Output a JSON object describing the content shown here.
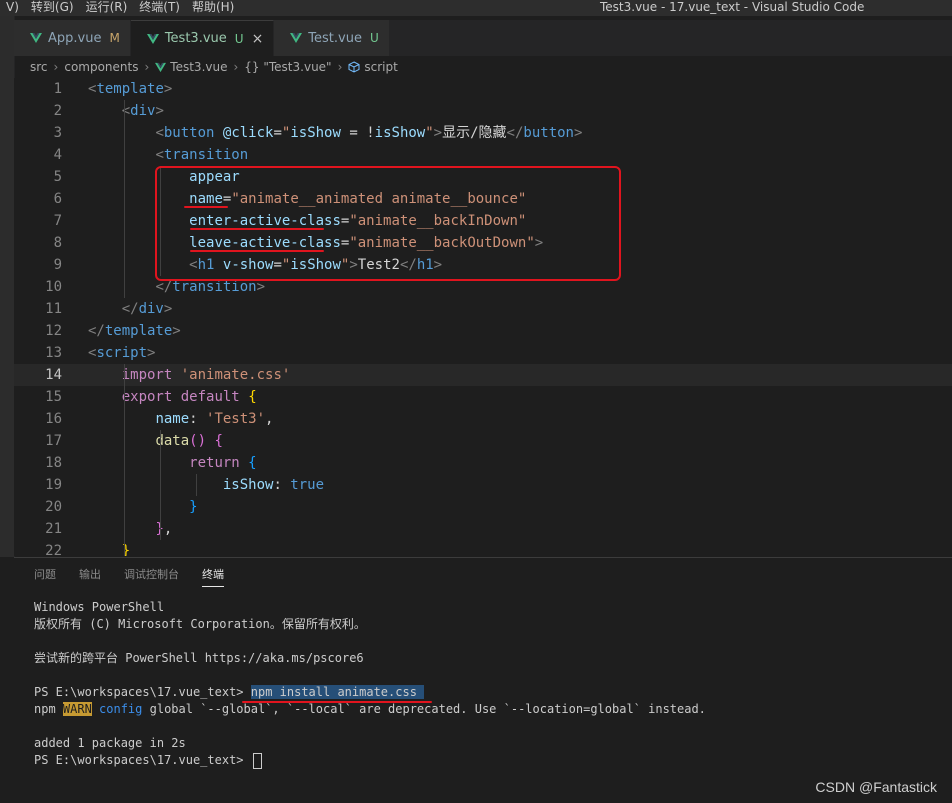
{
  "menu": [
    "V)",
    "转到(G)",
    "运行(R)",
    "终端(T)",
    "帮助(H)"
  ],
  "window_title": "Test3.vue - 17.vue_text - Visual Studio Code",
  "tabs": [
    {
      "label": "App.vue",
      "badge": "M",
      "active": false
    },
    {
      "label": "Test3.vue",
      "badge": "U",
      "active": true,
      "close": "×"
    },
    {
      "label": "Test.vue",
      "badge": "U",
      "active": false
    }
  ],
  "breadcrumb": [
    "src",
    "components",
    "Test3.vue",
    "{} \"Test3.vue\"",
    "script"
  ],
  "code_lines": [
    {
      "n": "1",
      "tokens": [
        [
          "t-punc",
          "<"
        ],
        [
          "t-tag",
          "template"
        ],
        [
          "t-punc",
          ">"
        ]
      ]
    },
    {
      "n": "2",
      "tokens": [
        [
          "t-text",
          "    "
        ],
        [
          "t-punc",
          "<"
        ],
        [
          "t-tag",
          "div"
        ],
        [
          "t-punc",
          ">"
        ]
      ]
    },
    {
      "n": "3",
      "tokens": [
        [
          "t-text",
          "        "
        ],
        [
          "t-punc",
          "<"
        ],
        [
          "t-tag",
          "button"
        ],
        [
          "t-text",
          " "
        ],
        [
          "t-attr",
          "@click"
        ],
        [
          "t-text",
          "="
        ],
        [
          "t-str",
          "\""
        ],
        [
          "t-attr",
          "isShow"
        ],
        [
          "t-text",
          " = "
        ],
        [
          "t-text",
          "!"
        ],
        [
          "t-attr",
          "isShow"
        ],
        [
          "t-str",
          "\""
        ],
        [
          "t-punc",
          ">"
        ],
        [
          "t-text",
          "显示/隐藏"
        ],
        [
          "t-punc",
          "</"
        ],
        [
          "t-tag",
          "button"
        ],
        [
          "t-punc",
          ">"
        ]
      ]
    },
    {
      "n": "4",
      "tokens": [
        [
          "t-text",
          "        "
        ],
        [
          "t-punc",
          "<"
        ],
        [
          "t-tag",
          "transition"
        ]
      ]
    },
    {
      "n": "5",
      "tokens": [
        [
          "t-text",
          "            "
        ],
        [
          "t-attr",
          "appear"
        ]
      ]
    },
    {
      "n": "6",
      "tokens": [
        [
          "t-text",
          "            "
        ],
        [
          "t-attr",
          "name"
        ],
        [
          "t-text",
          "="
        ],
        [
          "t-str",
          "\"animate__animated animate__bounce\""
        ]
      ]
    },
    {
      "n": "7",
      "tokens": [
        [
          "t-text",
          "            "
        ],
        [
          "t-attr",
          "enter-active-class"
        ],
        [
          "t-text",
          "="
        ],
        [
          "t-str",
          "\"animate__backInDown\""
        ]
      ]
    },
    {
      "n": "8",
      "tokens": [
        [
          "t-text",
          "            "
        ],
        [
          "t-attr",
          "leave-active-class"
        ],
        [
          "t-text",
          "="
        ],
        [
          "t-str",
          "\"animate__backOutDown\""
        ],
        [
          "t-punc",
          ">"
        ]
      ]
    },
    {
      "n": "9",
      "tokens": [
        [
          "t-text",
          "            "
        ],
        [
          "t-punc",
          "<"
        ],
        [
          "t-tag",
          "h1"
        ],
        [
          "t-text",
          " "
        ],
        [
          "t-attr",
          "v-show"
        ],
        [
          "t-text",
          "="
        ],
        [
          "t-str",
          "\""
        ],
        [
          "t-attr",
          "isShow"
        ],
        [
          "t-str",
          "\""
        ],
        [
          "t-punc",
          ">"
        ],
        [
          "t-text",
          "Test2"
        ],
        [
          "t-punc",
          "</"
        ],
        [
          "t-tag",
          "h1"
        ],
        [
          "t-punc",
          ">"
        ]
      ]
    },
    {
      "n": "10",
      "tokens": [
        [
          "t-text",
          "        "
        ],
        [
          "t-punc",
          "</"
        ],
        [
          "t-tag",
          "transition"
        ],
        [
          "t-punc",
          ">"
        ]
      ]
    },
    {
      "n": "11",
      "tokens": [
        [
          "t-text",
          "    "
        ],
        [
          "t-punc",
          "</"
        ],
        [
          "t-tag",
          "div"
        ],
        [
          "t-punc",
          ">"
        ]
      ]
    },
    {
      "n": "12",
      "tokens": [
        [
          "t-punc",
          "</"
        ],
        [
          "t-tag",
          "template"
        ],
        [
          "t-punc",
          ">"
        ]
      ]
    },
    {
      "n": "13",
      "tokens": [
        [
          "t-punc",
          "<"
        ],
        [
          "t-tag",
          "script"
        ],
        [
          "t-punc",
          ">"
        ]
      ]
    },
    {
      "n": "14",
      "tokens": [
        [
          "t-text",
          "    "
        ],
        [
          "t-kw",
          "import"
        ],
        [
          "t-text",
          " "
        ],
        [
          "t-str",
          "'animate.css'"
        ]
      ],
      "current": true
    },
    {
      "n": "15",
      "tokens": [
        [
          "t-text",
          "    "
        ],
        [
          "t-kw",
          "export"
        ],
        [
          "t-text",
          " "
        ],
        [
          "t-kw",
          "default"
        ],
        [
          "t-text",
          " "
        ],
        [
          "t-b1",
          "{"
        ]
      ]
    },
    {
      "n": "16",
      "tokens": [
        [
          "t-text",
          "        "
        ],
        [
          "t-prop",
          "name"
        ],
        [
          "t-text",
          ": "
        ],
        [
          "t-str",
          "'Test3'"
        ],
        [
          "t-text",
          ","
        ]
      ]
    },
    {
      "n": "17",
      "tokens": [
        [
          "t-text",
          "        "
        ],
        [
          "t-fn",
          "data"
        ],
        [
          "t-b2",
          "()"
        ],
        [
          "t-text",
          " "
        ],
        [
          "t-b2",
          "{"
        ]
      ]
    },
    {
      "n": "18",
      "tokens": [
        [
          "t-text",
          "            "
        ],
        [
          "t-kw",
          "return"
        ],
        [
          "t-text",
          " "
        ],
        [
          "t-b3",
          "{"
        ]
      ]
    },
    {
      "n": "19",
      "tokens": [
        [
          "t-text",
          "                "
        ],
        [
          "t-prop",
          "isShow"
        ],
        [
          "t-text",
          ": "
        ],
        [
          "t-blue",
          "true"
        ]
      ]
    },
    {
      "n": "20",
      "tokens": [
        [
          "t-text",
          "            "
        ],
        [
          "t-b3",
          "}"
        ]
      ]
    },
    {
      "n": "21",
      "tokens": [
        [
          "t-text",
          "        "
        ],
        [
          "t-b2",
          "}"
        ],
        [
          "t-text",
          ","
        ]
      ]
    },
    {
      "n": "22",
      "tokens": [
        [
          "t-text",
          "    "
        ],
        [
          "t-b1",
          "}"
        ]
      ]
    }
  ],
  "panel_tabs": [
    {
      "label": "问题",
      "active": false
    },
    {
      "label": "输出",
      "active": false
    },
    {
      "label": "调试控制台",
      "active": false
    },
    {
      "label": "终端",
      "active": true
    }
  ],
  "terminal": {
    "line1": "Windows PowerShell",
    "line2": "版权所有 (C) Microsoft Corporation。保留所有权利。",
    "line3": "尝试新的跨平台 PowerShell https://aka.ms/pscore6",
    "prompt1": "PS E:\\workspaces\\17.vue_text> ",
    "command": "npm install animate.css ",
    "warn_prefix": "npm ",
    "warn_badge": "WARN",
    "warn_config": " config",
    "warn_rest": " global `--global`, `--local` are deprecated. Use `--location=global` instead.",
    "added": "added 1 package in 2s",
    "prompt2": "PS E:\\workspaces\\17.vue_text> "
  },
  "watermark": "CSDN @Fantastick",
  "colors": {
    "annotation_red": "#e0141e",
    "vue_green": "#41b883"
  }
}
